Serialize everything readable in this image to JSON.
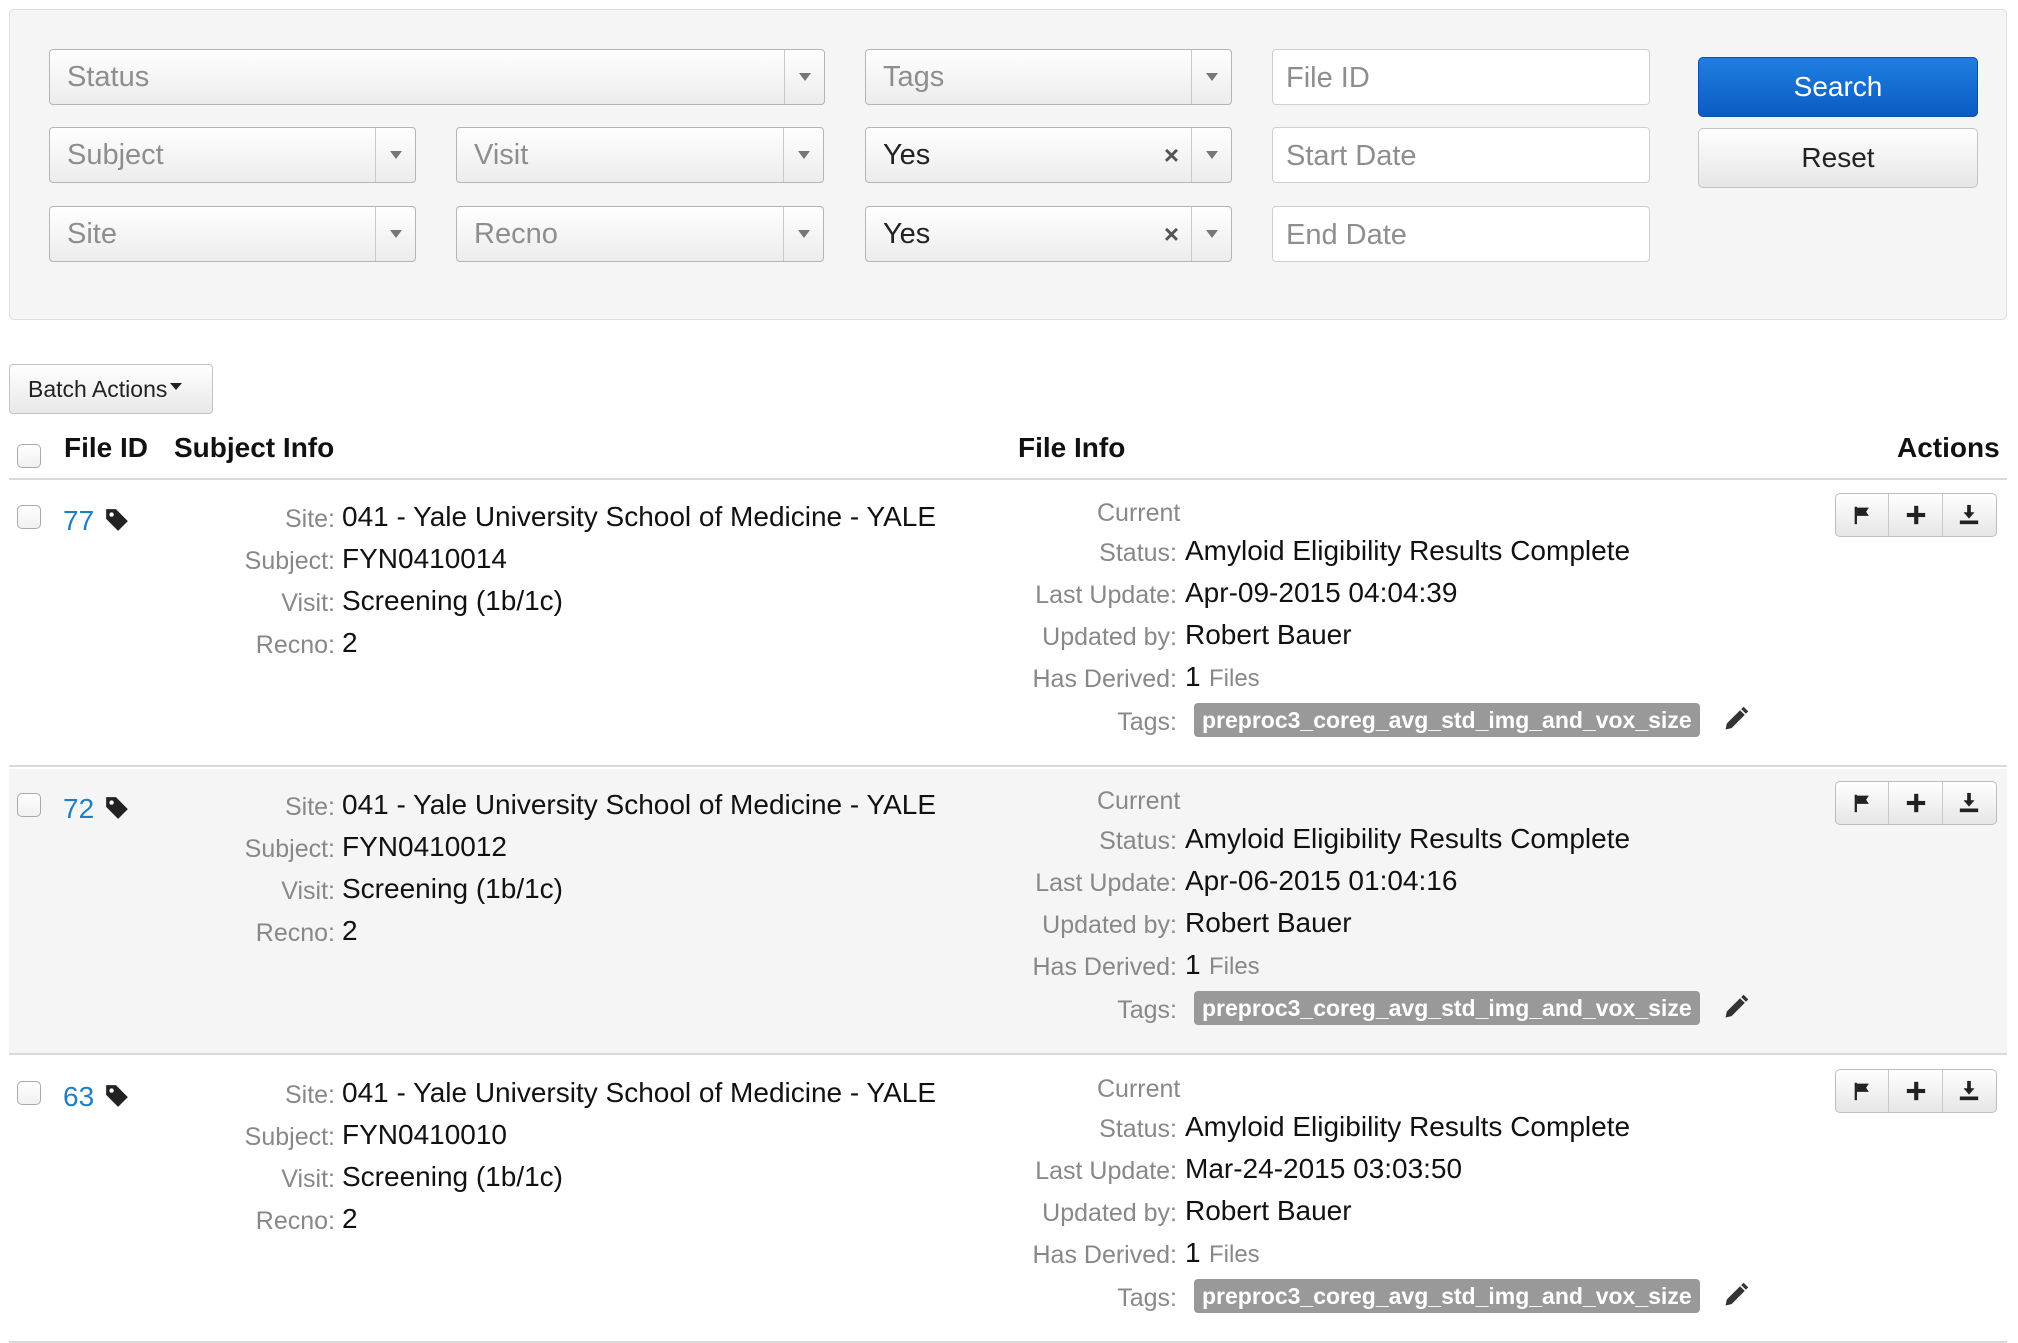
{
  "filters": {
    "status_placeholder": "Status",
    "tags_placeholder": "Tags",
    "file_id_placeholder": "File ID",
    "subject_placeholder": "Subject",
    "visit_placeholder": "Visit",
    "filter_one_value": "Yes",
    "start_date_placeholder": "Start Date",
    "site_placeholder": "Site",
    "recno_placeholder": "Recno",
    "filter_two_value": "Yes",
    "end_date_placeholder": "End Date",
    "clear_symbol": "×",
    "search_label": "Search",
    "reset_label": "Reset"
  },
  "batch_actions_label": "Batch Actions",
  "table": {
    "headers": {
      "file_id": "File ID",
      "subject_info": "Subject Info",
      "file_info": "File Info",
      "actions": "Actions"
    },
    "labels": {
      "site": "Site:",
      "subject": "Subject:",
      "visit": "Visit:",
      "recno": "Recno:",
      "current": "Current",
      "status": "Status:",
      "last_update": "Last Update:",
      "updated_by": "Updated by:",
      "has_derived": "Has Derived:",
      "files": "Files",
      "tags": "Tags:"
    },
    "rows": [
      {
        "file_id": "77",
        "site": "041 - Yale University School of Medicine - YALE",
        "subject": "FYN0410014",
        "visit": "Screening (1b/1c)",
        "recno": "2",
        "status": "Amyloid Eligibility Results Complete",
        "last_update": "Apr-09-2015 04:04:39",
        "updated_by": "Robert Bauer",
        "derived_count": "1",
        "tag": "preproc3_coreg_avg_std_img_and_vox_size"
      },
      {
        "file_id": "72",
        "site": "041 - Yale University School of Medicine - YALE",
        "subject": "FYN0410012",
        "visit": "Screening (1b/1c)",
        "recno": "2",
        "status": "Amyloid Eligibility Results Complete",
        "last_update": "Apr-06-2015 01:04:16",
        "updated_by": "Robert Bauer",
        "derived_count": "1",
        "tag": "preproc3_coreg_avg_std_img_and_vox_size"
      },
      {
        "file_id": "63",
        "site": "041 - Yale University School of Medicine - YALE",
        "subject": "FYN0410010",
        "visit": "Screening (1b/1c)",
        "recno": "2",
        "status": "Amyloid Eligibility Results Complete",
        "last_update": "Mar-24-2015 03:03:50",
        "updated_by": "Robert Bauer",
        "derived_count": "1",
        "tag": "preproc3_coreg_avg_std_img_and_vox_size"
      }
    ]
  },
  "icons": {
    "tag": "tag-icon",
    "edit": "pencil-icon",
    "flag": "flag-icon",
    "add": "plus-icon",
    "download": "download-icon"
  },
  "colors": {
    "primary": "#0b5cc2",
    "link": "#1e7fc4",
    "tag_pill": "#999999",
    "stripe": "#f5f5f5"
  }
}
